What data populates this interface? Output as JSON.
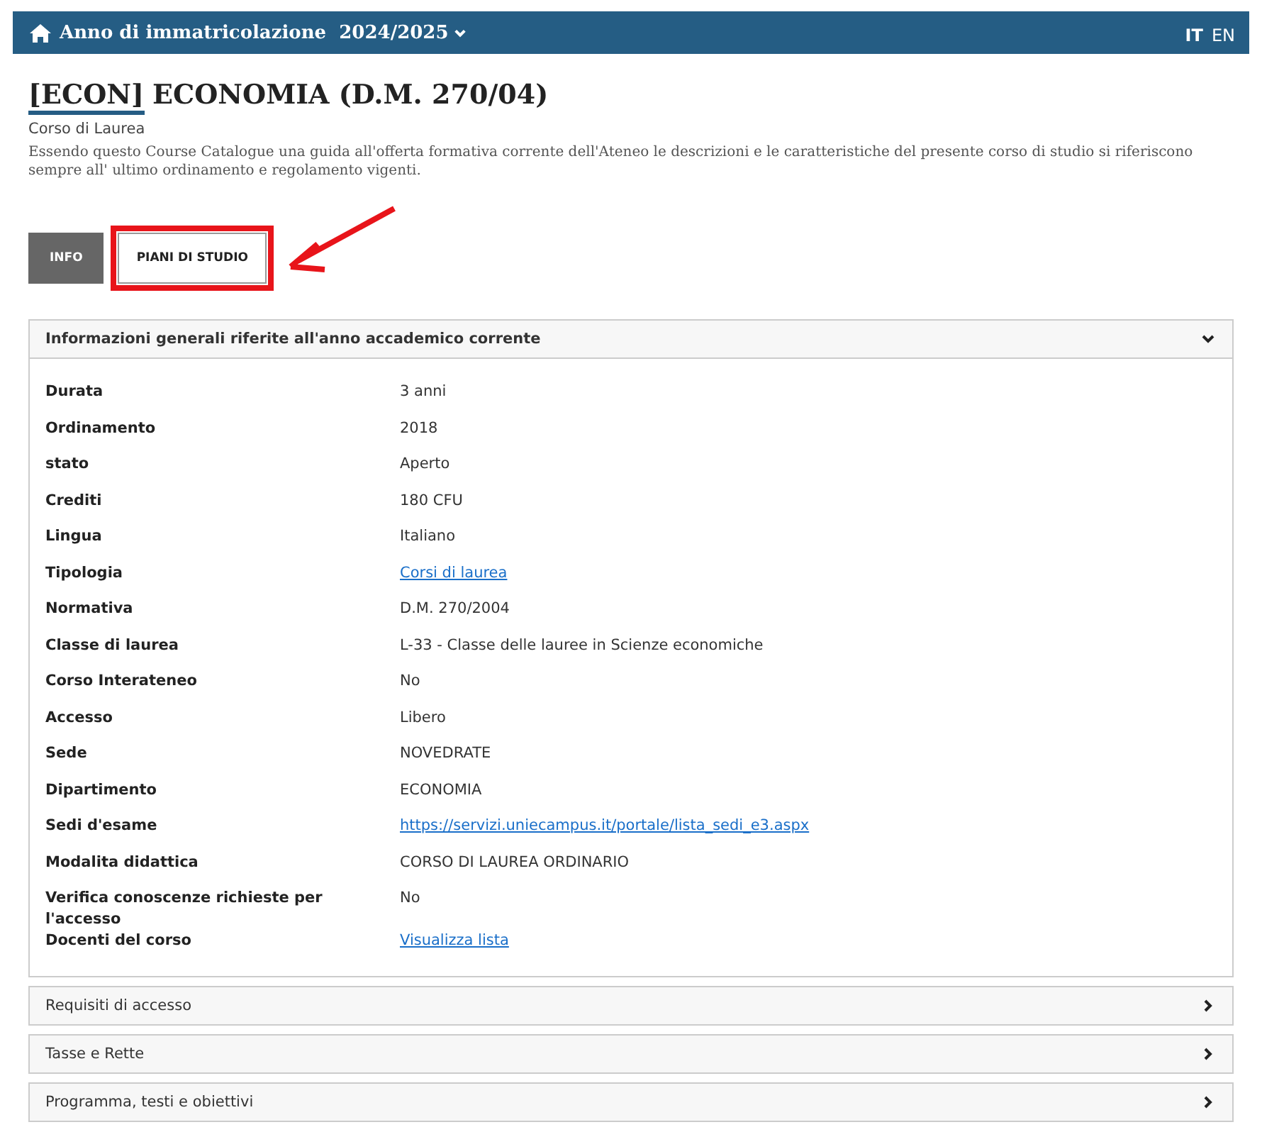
{
  "top_bar": {
    "year_label": "Anno di immatricolazione",
    "year": "2024/2025",
    "languages": [
      {
        "code": "IT",
        "selected": true
      },
      {
        "code": "EN",
        "selected": false
      }
    ]
  },
  "title_code": "[ECON]",
  "title_rest": "ECONOMIA (D.M. 270/04)",
  "subtitle": "Corso di Laurea",
  "description": "Essendo questo Course Catalogue una guida all'offerta formativa corrente dell'Ateneo le descrizioni e le caratteristiche del presente corso di studio si riferiscono sempre all' ultimo ordinamento e regolamento vigenti.",
  "tabs": [
    {
      "label": "INFO",
      "selected": true,
      "highlighted": false
    },
    {
      "label": "PIANI DI STUDIO",
      "selected": false,
      "highlighted": true
    }
  ],
  "sections": [
    {
      "title": "Informazioni generali riferite all'anno accademico corrente",
      "expanded": true,
      "rows": [
        {
          "label": "Durata",
          "value": "3 anni",
          "link": false
        },
        {
          "label": "Ordinamento",
          "value": "2018",
          "link": false
        },
        {
          "label": "stato",
          "value": "Aperto",
          "link": false
        },
        {
          "label": "Crediti",
          "value": "180 CFU",
          "link": false
        },
        {
          "label": "Lingua",
          "value": "Italiano",
          "link": false
        },
        {
          "label": "Tipologia",
          "value": "Corsi di laurea",
          "link": true
        },
        {
          "label": "Normativa",
          "value": "D.M. 270/2004",
          "link": false
        },
        {
          "label": "Classe di laurea",
          "value": "L-33 - Classe delle lauree in Scienze economiche",
          "link": false
        },
        {
          "label": "Corso Interateneo",
          "value": "No",
          "link": false
        },
        {
          "label": "Accesso",
          "value": "Libero",
          "link": false
        },
        {
          "label": "Sede",
          "value": "NOVEDRATE",
          "link": false
        },
        {
          "label": "Dipartimento",
          "value": "ECONOMIA",
          "link": false
        },
        {
          "label": "Sedi d'esame",
          "value": "https://servizi.uniecampus.it/portale/lista_sedi_e3.aspx",
          "link": true
        },
        {
          "label": "Modalita didattica",
          "value": "CORSO DI LAUREA ORDINARIO",
          "link": false
        },
        {
          "label": "Verifica conoscenze richieste per l'accesso",
          "value": "No",
          "link": false
        },
        {
          "label": "Docenti del corso",
          "value": "Visualizza lista",
          "link": true
        }
      ]
    },
    {
      "title": "Requisiti di accesso",
      "expanded": false
    },
    {
      "title": "Tasse e Rette",
      "expanded": false
    },
    {
      "title": "Programma, testi e obiettivi",
      "expanded": false
    }
  ]
}
